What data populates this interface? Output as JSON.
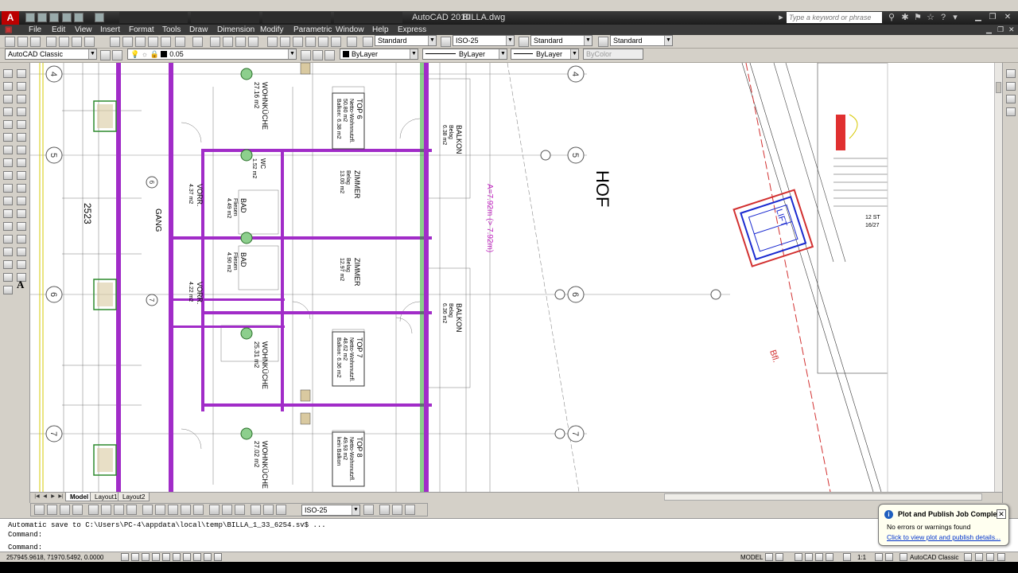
{
  "app": {
    "title": "AutoCAD 2010",
    "filename": "BILLA.dwg",
    "search_placeholder": "Type a keyword or phrase"
  },
  "menu": [
    "File",
    "Edit",
    "View",
    "Insert",
    "Format",
    "Tools",
    "Draw",
    "Dimension",
    "Modify",
    "Parametric",
    "Window",
    "Help",
    "Express"
  ],
  "toolbar_styles": {
    "text_style": "Standard",
    "dim_style": "ISO-25",
    "table_style": "Standard",
    "multileader_style": "Standard"
  },
  "toolbar_layers": {
    "workspace": "AutoCAD Classic",
    "layer": "0.05",
    "color": "ByLayer",
    "linetype": "ByLayer",
    "lineweight": "ByLayer",
    "plotstyle": "ByColor"
  },
  "layout_tabs": [
    "Model",
    "Layout1",
    "Layout2"
  ],
  "dim_toolbar": {
    "dim_style": "ISO-25"
  },
  "command_window": {
    "lines": [
      "Automatic save to C:\\Users\\PC-4\\appdata\\local\\temp\\BILLA_1_33_6254.sv$ ...",
      "Command:",
      "Command:"
    ]
  },
  "status_bar": {
    "coordinates": "257945.9618, 71970.5492, 0.0000",
    "model_label": "MODEL",
    "annotation_scale": "1:1",
    "workspace": "AutoCAD Classic"
  },
  "notification": {
    "title": "Plot and Publish Job Complete",
    "message": "No errors or warnings found",
    "link": "Click to view plot and publish details..."
  },
  "drawing": {
    "grid_bubbles_left": [
      "4",
      "5",
      "6",
      "7"
    ],
    "grid_bubbles_right": [
      "4",
      "5",
      "6",
      "7"
    ],
    "axis_bubbles": [
      "6",
      "7"
    ],
    "hof_label": "HOF",
    "dimension_2523": "2523",
    "gang_label": "GANG",
    "rooms": [
      {
        "name": "WOHNKÜCHE",
        "area": "27.16 m2"
      },
      {
        "name": "WOHNKÜCHE",
        "area": "25.31 m2"
      },
      {
        "name": "WOHNKÜCHE",
        "area": "27.02 m2"
      },
      {
        "name": "ZIMMER",
        "sub": "Belag",
        "area": "13.00 m2"
      },
      {
        "name": "ZIMMER",
        "sub": "Belag",
        "area": "12.97 m2"
      },
      {
        "name": "BALKON",
        "sub": "Belag",
        "area": "6.38 m2"
      },
      {
        "name": "BALKON",
        "sub": "Belag",
        "area": "6.36 m2"
      },
      {
        "name": "BAD",
        "sub": "Fliesen",
        "area": "4.49 m2"
      },
      {
        "name": "BAD",
        "sub": "Fliesen",
        "area": "4.90 m2"
      },
      {
        "name": "VORR.",
        "area": "4.37 m2"
      },
      {
        "name": "VORR.",
        "area": "4.22 m2"
      },
      {
        "name": "WC",
        "area": "1.52 m2"
      }
    ],
    "apartments": [
      {
        "name": "TOP 6",
        "line1": "Netto-Wohnnutzfl.",
        "line2": "50.80 m2",
        "line3": "Balkon: 6.38 m2"
      },
      {
        "name": "TOP 7",
        "line1": "Netto-Wohnnutzfl.",
        "line2": "48.62 m2",
        "line3": "Balkon: 6.36 m2"
      },
      {
        "name": "TOP 8",
        "line1": "Netto-Wohnnutzfl.",
        "line2": "49.93 m2",
        "line3": "kein Balkon"
      }
    ],
    "annotation_magenta": "A=7.92m (> 7.92m)",
    "lift_label": "LIFT",
    "btl_label": "Bfl.",
    "st_label": "12 ST",
    "st_sub": "16/27"
  }
}
